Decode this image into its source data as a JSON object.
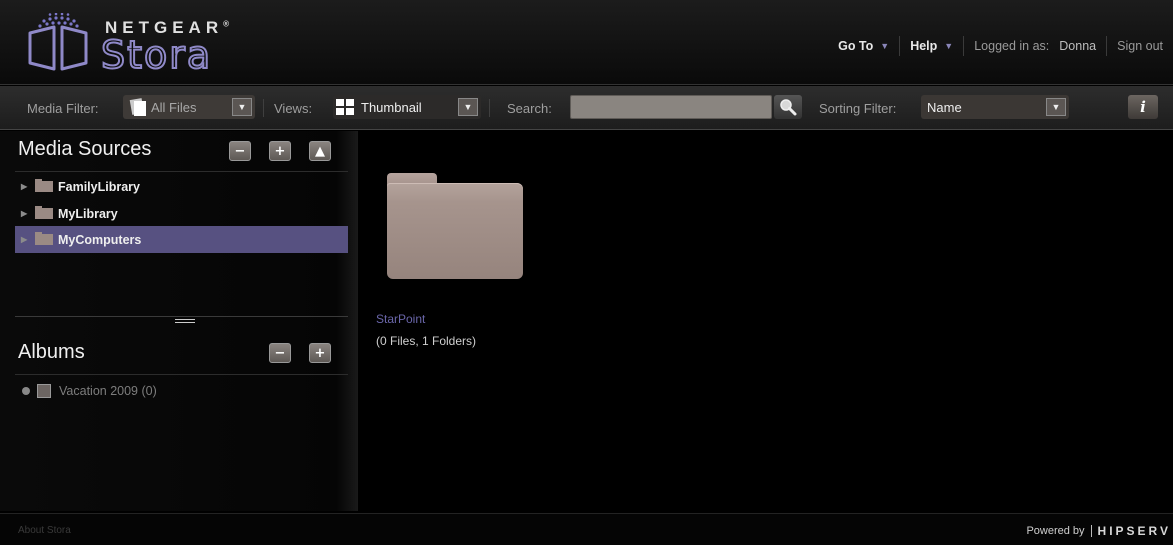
{
  "header": {
    "brand": "NETGEAR",
    "product": "Stora",
    "nav": {
      "goto_label": "Go To",
      "help_label": "Help",
      "logged_in_label": "Logged in as:",
      "user_name": "Donna",
      "signout_label": "Sign out"
    }
  },
  "toolbar": {
    "media_filter_label": "Media Filter:",
    "media_filter_value": "All Files",
    "views_label": "Views:",
    "views_value": "Thumbnail",
    "search_label": "Search:",
    "search_value": "",
    "sorting_label": "Sorting Filter:",
    "sorting_value": "Name",
    "info_glyph": "i"
  },
  "sidebar": {
    "media_sources": {
      "title": "Media Sources",
      "items": [
        {
          "label": "FamilyLibrary",
          "selected": false
        },
        {
          "label": "MyLibrary",
          "selected": false
        },
        {
          "label": "MyComputers",
          "selected": true
        }
      ]
    },
    "albums": {
      "title": "Albums",
      "items": [
        {
          "label": "Vacation 2009 (0)"
        }
      ]
    }
  },
  "main": {
    "items": [
      {
        "name": "StarPoint",
        "summary": "(0 Files, 1 Folders)"
      }
    ]
  },
  "footer": {
    "about_label": "About Stora",
    "powered_label": "Powered by",
    "powered_brand": "HIPSERV"
  },
  "colors": {
    "accent": "#575181",
    "link": "#6a66aa",
    "folder": "#a6948d"
  }
}
